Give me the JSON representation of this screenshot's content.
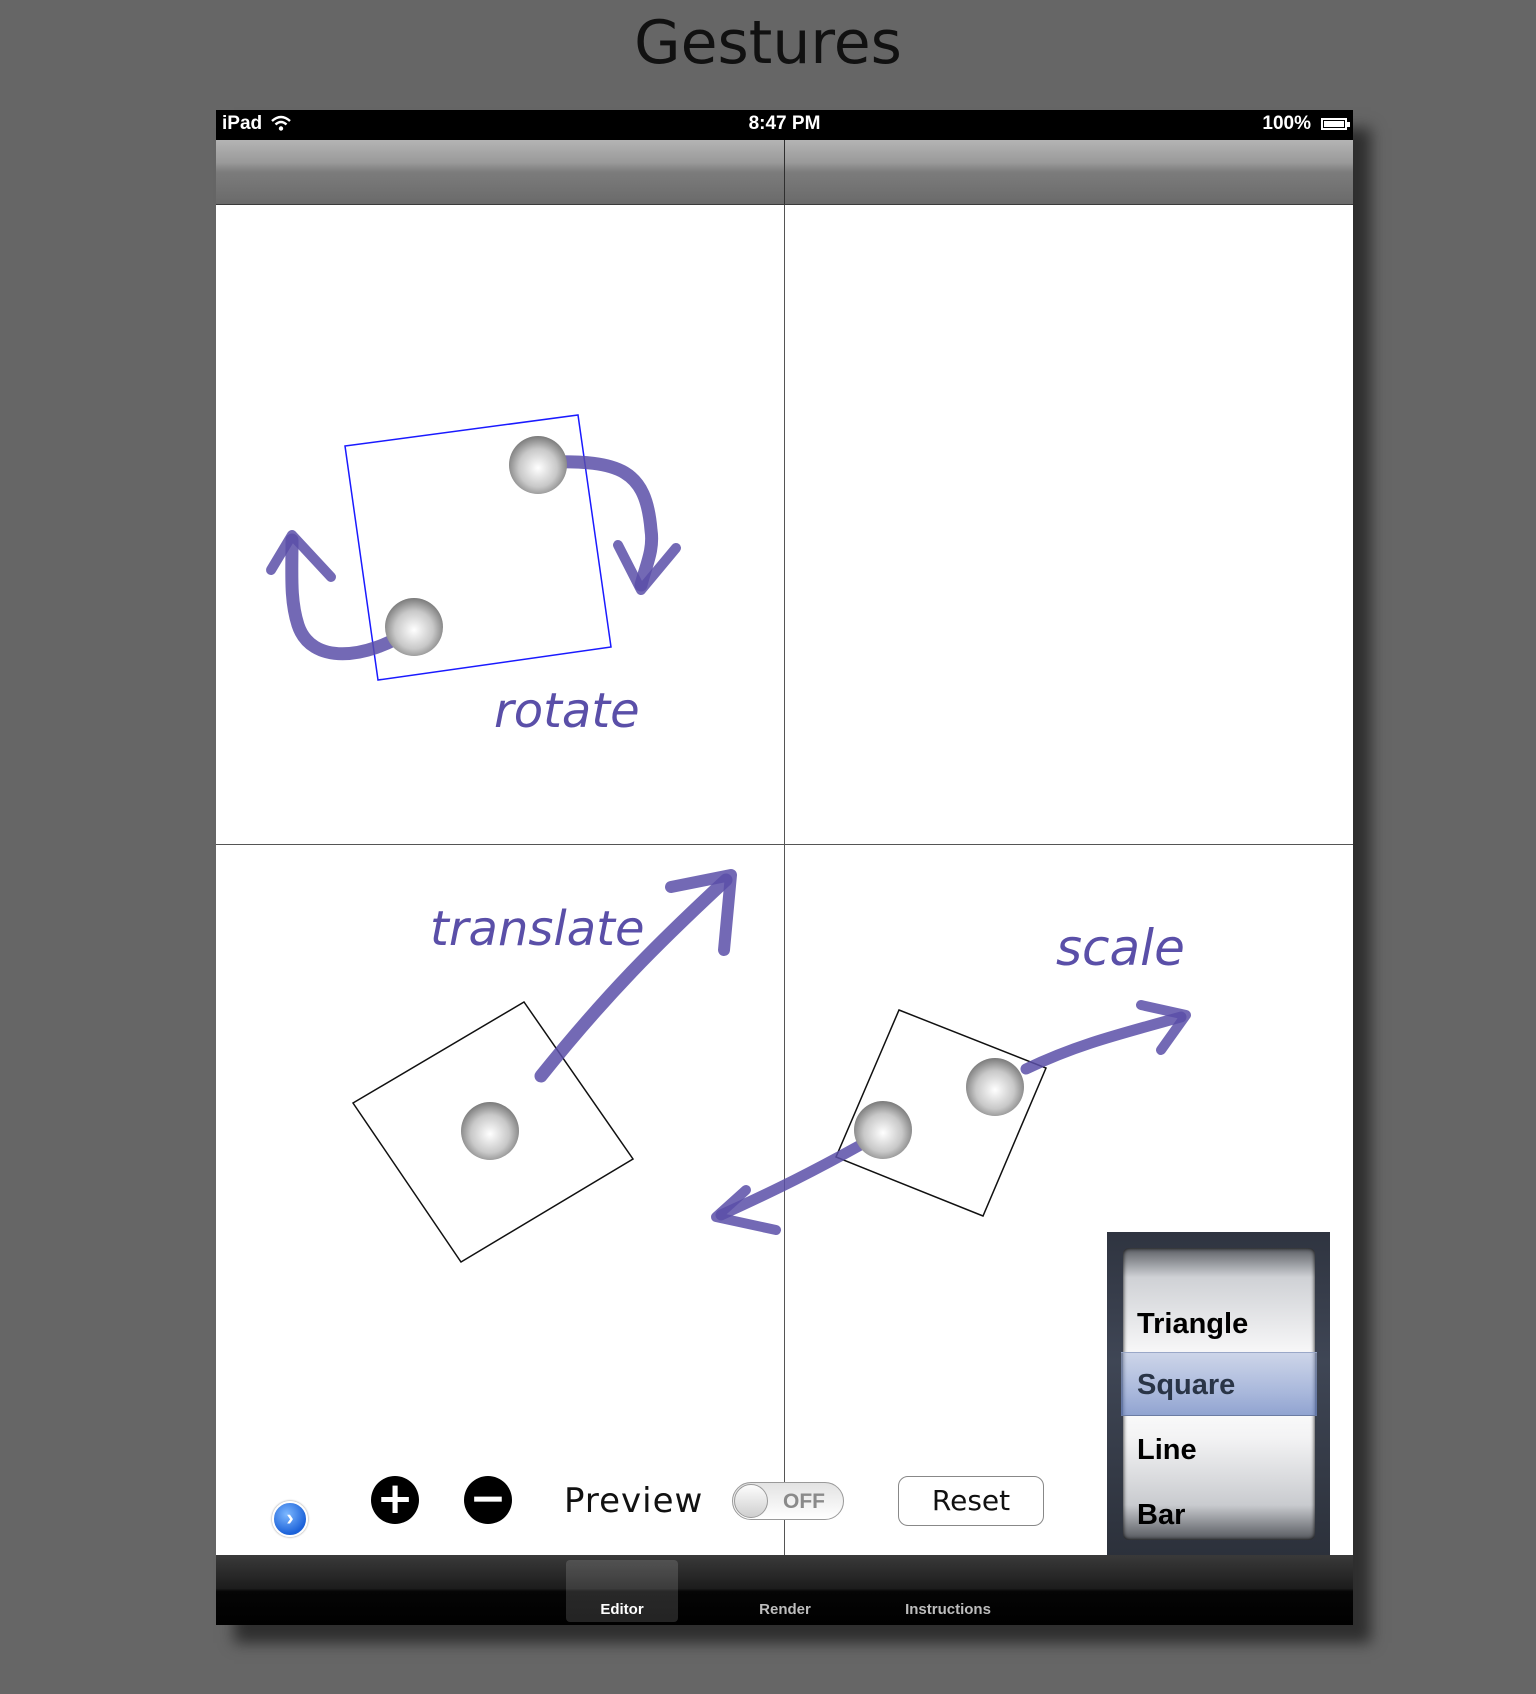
{
  "slide": {
    "title": "Gestures"
  },
  "status_bar": {
    "carrier": "iPad",
    "time": "8:47 PM",
    "battery": "100%"
  },
  "annotations": {
    "rotate": "rotate",
    "translate": "translate",
    "scale": "scale"
  },
  "toolbar": {
    "disclosure_icon": "chevron-right",
    "zoom_in_glyph": "+",
    "zoom_out_glyph": "−",
    "preview_label": "Preview",
    "preview_toggle_state": "OFF",
    "reset_label": "Reset"
  },
  "shape_picker": {
    "options": [
      "Triangle",
      "Square",
      "Line",
      "Bar"
    ],
    "selected": "Square"
  },
  "tabs": [
    {
      "label": "Editor",
      "selected": true
    },
    {
      "label": "Render",
      "selected": false
    },
    {
      "label": "Instructions",
      "selected": false
    }
  ],
  "colors": {
    "background": "#666666",
    "annotation_ink": "#5a4fa8",
    "rotate_square": "#1a1aff",
    "disclosure_blue": "#1c62d9"
  }
}
